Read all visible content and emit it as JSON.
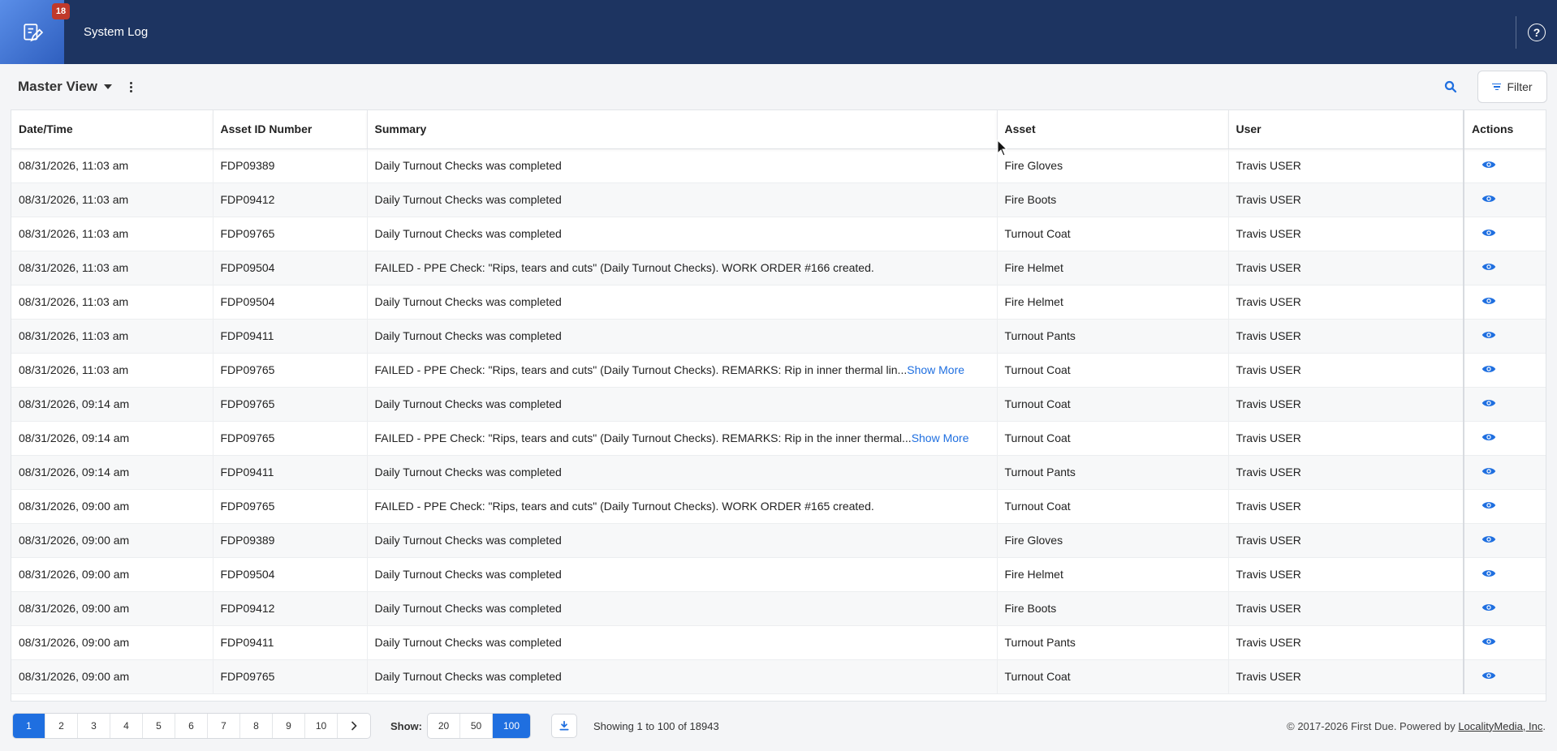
{
  "header": {
    "title": "System Log",
    "notification_count": "18",
    "logo_icon": "logbook-icon",
    "help_icon": "help-icon"
  },
  "toolbar": {
    "view_name": "Master View",
    "filter_label": "Filter"
  },
  "table": {
    "columns": [
      "Date/Time",
      "Asset ID Number",
      "Summary",
      "Asset",
      "User",
      "Actions"
    ],
    "rows": [
      {
        "datetime": "08/31/2026, 11:03 am",
        "asset_id": "FDP09389",
        "summary": "Daily Turnout Checks was completed",
        "show_more": "",
        "asset": "Fire Gloves",
        "user": "Travis USER"
      },
      {
        "datetime": "08/31/2026, 11:03 am",
        "asset_id": "FDP09412",
        "summary": "Daily Turnout Checks was completed",
        "show_more": "",
        "asset": "Fire Boots",
        "user": "Travis USER"
      },
      {
        "datetime": "08/31/2026, 11:03 am",
        "asset_id": "FDP09765",
        "summary": "Daily Turnout Checks was completed",
        "show_more": "",
        "asset": "Turnout Coat",
        "user": "Travis USER"
      },
      {
        "datetime": "08/31/2026, 11:03 am",
        "asset_id": "FDP09504",
        "summary": "FAILED - PPE Check: \"Rips, tears and cuts\" (Daily Turnout Checks). WORK ORDER #166 created.",
        "show_more": "",
        "asset": "Fire Helmet",
        "user": "Travis USER"
      },
      {
        "datetime": "08/31/2026, 11:03 am",
        "asset_id": "FDP09504",
        "summary": "Daily Turnout Checks was completed",
        "show_more": "",
        "asset": "Fire Helmet",
        "user": "Travis USER"
      },
      {
        "datetime": "08/31/2026, 11:03 am",
        "asset_id": "FDP09411",
        "summary": "Daily Turnout Checks was completed",
        "show_more": "",
        "asset": "Turnout Pants",
        "user": "Travis USER"
      },
      {
        "datetime": "08/31/2026, 11:03 am",
        "asset_id": "FDP09765",
        "summary": "FAILED - PPE Check: \"Rips, tears and cuts\" (Daily Turnout Checks). REMARKS: Rip in inner thermal lin...",
        "show_more": "Show More",
        "asset": "Turnout Coat",
        "user": "Travis USER"
      },
      {
        "datetime": "08/31/2026, 09:14 am",
        "asset_id": "FDP09765",
        "summary": "Daily Turnout Checks was completed",
        "show_more": "",
        "asset": "Turnout Coat",
        "user": "Travis USER"
      },
      {
        "datetime": "08/31/2026, 09:14 am",
        "asset_id": "FDP09765",
        "summary": "FAILED - PPE Check: \"Rips, tears and cuts\" (Daily Turnout Checks). REMARKS: Rip in the inner thermal...",
        "show_more": "Show More",
        "asset": "Turnout Coat",
        "user": "Travis USER"
      },
      {
        "datetime": "08/31/2026, 09:14 am",
        "asset_id": "FDP09411",
        "summary": "Daily Turnout Checks was completed",
        "show_more": "",
        "asset": "Turnout Pants",
        "user": "Travis USER"
      },
      {
        "datetime": "08/31/2026, 09:00 am",
        "asset_id": "FDP09765",
        "summary": "FAILED - PPE Check: \"Rips, tears and cuts\" (Daily Turnout Checks). WORK ORDER #165 created.",
        "show_more": "",
        "asset": "Turnout Coat",
        "user": "Travis USER"
      },
      {
        "datetime": "08/31/2026, 09:00 am",
        "asset_id": "FDP09389",
        "summary": "Daily Turnout Checks was completed",
        "show_more": "",
        "asset": "Fire Gloves",
        "user": "Travis USER"
      },
      {
        "datetime": "08/31/2026, 09:00 am",
        "asset_id": "FDP09504",
        "summary": "Daily Turnout Checks was completed",
        "show_more": "",
        "asset": "Fire Helmet",
        "user": "Travis USER"
      },
      {
        "datetime": "08/31/2026, 09:00 am",
        "asset_id": "FDP09412",
        "summary": "Daily Turnout Checks was completed",
        "show_more": "",
        "asset": "Fire Boots",
        "user": "Travis USER"
      },
      {
        "datetime": "08/31/2026, 09:00 am",
        "asset_id": "FDP09411",
        "summary": "Daily Turnout Checks was completed",
        "show_more": "",
        "asset": "Turnout Pants",
        "user": "Travis USER"
      },
      {
        "datetime": "08/31/2026, 09:00 am",
        "asset_id": "FDP09765",
        "summary": "Daily Turnout Checks was completed",
        "show_more": "",
        "asset": "Turnout Coat",
        "user": "Travis USER"
      }
    ],
    "action_icon": "eye-icon"
  },
  "footer": {
    "pages": [
      "1",
      "2",
      "3",
      "4",
      "5",
      "6",
      "7",
      "8",
      "9",
      "10"
    ],
    "active_page": "1",
    "next_icon": "chevron-right-icon",
    "show_label": "Show:",
    "page_sizes": [
      "20",
      "50",
      "100"
    ],
    "active_page_size": "100",
    "download_icon": "download-icon",
    "showing_text": "Showing 1 to 100 of 18943",
    "copyright_prefix": "© 2017-2026 First Due. Powered by ",
    "copyright_link": "LocalityMedia, Inc",
    "copyright_suffix": "."
  },
  "colors": {
    "header_bg": "#1d3461",
    "accent": "#1f6fe0",
    "badge": "#c0392b"
  }
}
